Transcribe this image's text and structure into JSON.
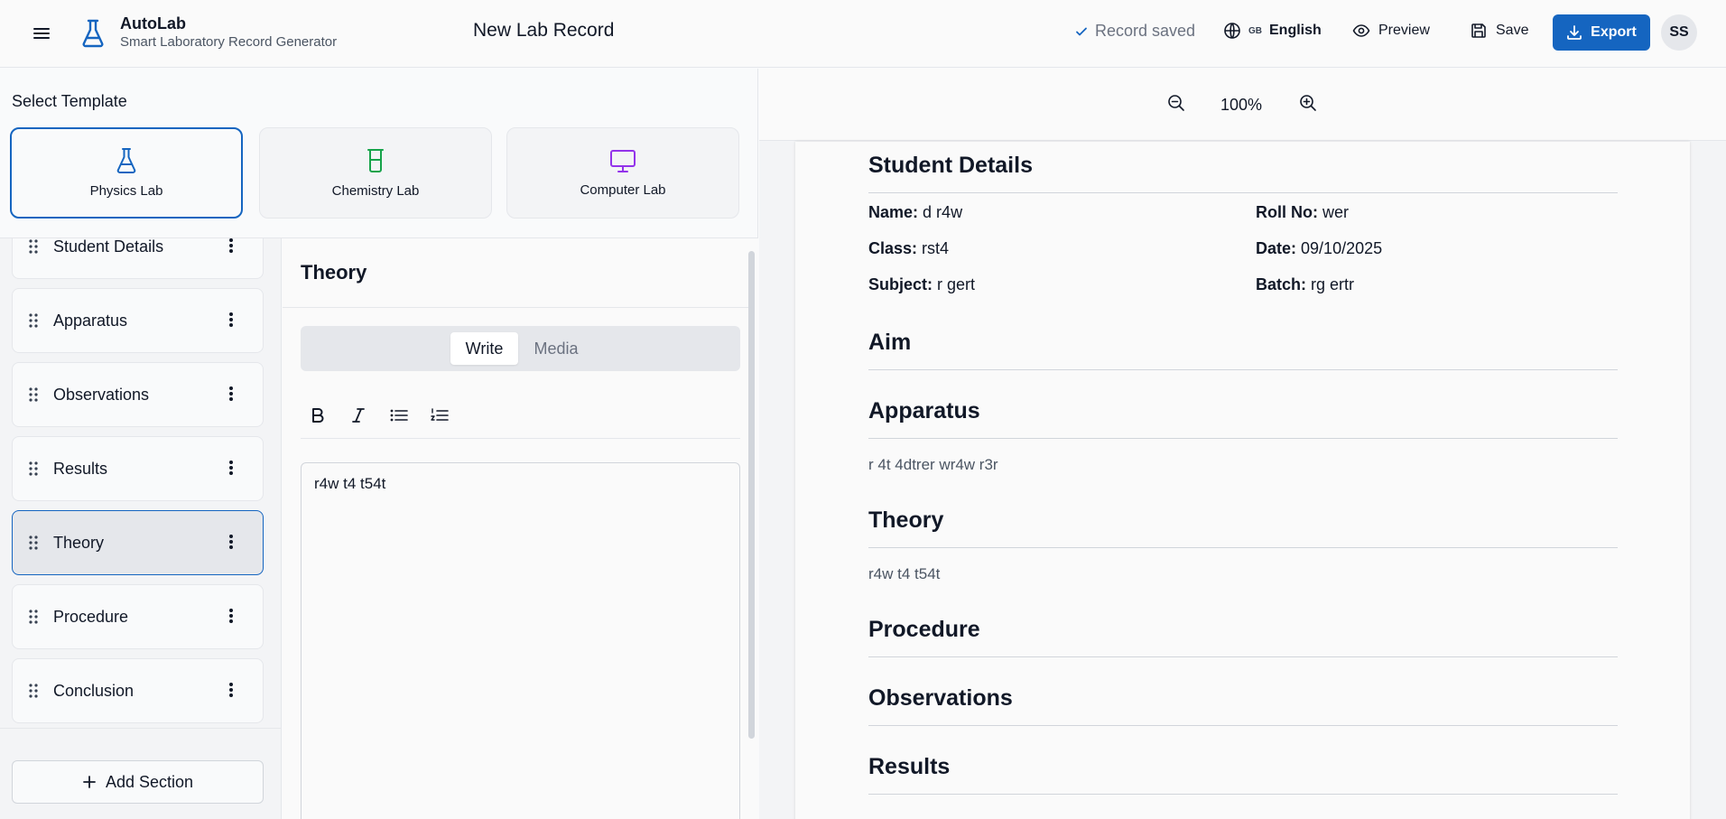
{
  "header": {
    "brand_name": "AutoLab",
    "brand_tagline": "Smart Laboratory Record Generator",
    "doc_title": "New Lab Record",
    "saved_status": "Record saved",
    "language_flag": "GB",
    "language": "English",
    "preview_label": "Preview",
    "save_label": "Save",
    "export_label": "Export",
    "avatar_initials": "SS",
    "accent": "#1565c0"
  },
  "templates": {
    "label": "Select Template",
    "items": [
      {
        "label": "Physics Lab",
        "icon": "flask-icon",
        "color": "#1565c0",
        "active": true
      },
      {
        "label": "Chemistry Lab",
        "icon": "beaker-icon",
        "color": "#16a34a",
        "active": false
      },
      {
        "label": "Computer Lab",
        "icon": "monitor-icon",
        "color": "#9333ea",
        "active": false
      }
    ]
  },
  "sections": {
    "items": [
      {
        "label": "Student Details"
      },
      {
        "label": "Apparatus"
      },
      {
        "label": "Observations"
      },
      {
        "label": "Results"
      },
      {
        "label": "Theory",
        "active": true
      },
      {
        "label": "Procedure"
      },
      {
        "label": "Conclusion"
      }
    ],
    "add_label": "Add Section"
  },
  "editor": {
    "title": "Theory",
    "tabs": [
      "Write",
      "Media"
    ],
    "active_tab": "Write",
    "content": "r4w t4 t54t"
  },
  "preview": {
    "zoom": "100%",
    "student_heading": "Student Details",
    "fields": {
      "name_label": "Name:",
      "name_value": "d r4w",
      "roll_label": "Roll No:",
      "roll_value": "wer",
      "class_label": "Class:",
      "class_value": "rst4",
      "date_label": "Date:",
      "date_value": "09/10/2025",
      "subject_label": "Subject:",
      "subject_value": "r gert",
      "batch_label": "Batch:",
      "batch_value": "rg ertr"
    },
    "aim_heading": "Aim",
    "apparatus_heading": "Apparatus",
    "apparatus_text": "r 4t 4dtrer wr4w r3r",
    "theory_heading": "Theory",
    "theory_text": "r4w t4 t54t",
    "procedure_heading": "Procedure",
    "observations_heading": "Observations",
    "results_heading": "Results"
  }
}
